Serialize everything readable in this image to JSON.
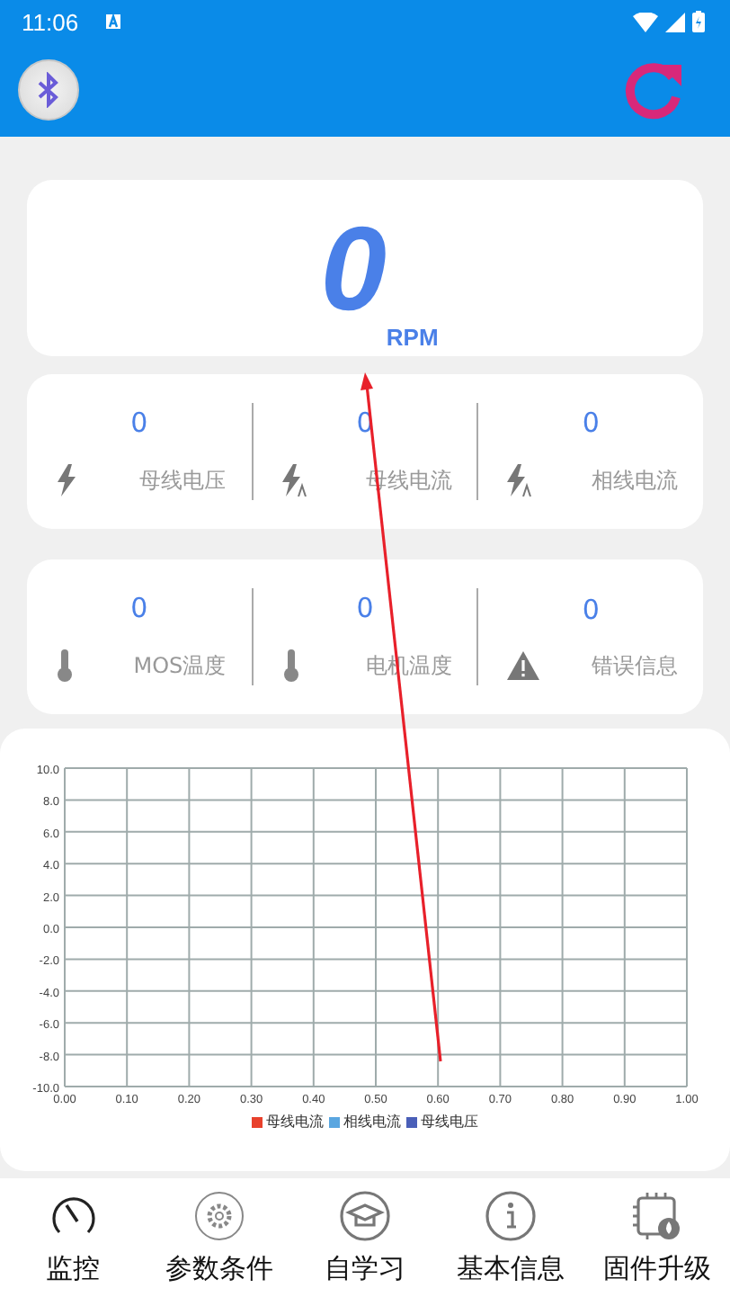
{
  "status_bar": {
    "time": "11:06"
  },
  "speed": {
    "value": "0",
    "unit": "RPM"
  },
  "electrical": [
    {
      "kind": "bolt",
      "value": "0",
      "label": "母线电压"
    },
    {
      "kind": "bolt_a",
      "value": "0",
      "label": "母线电流"
    },
    {
      "kind": "bolt_a",
      "value": "0",
      "label": "相线电流"
    }
  ],
  "thermal": [
    {
      "kind": "thermometer",
      "value": "0",
      "label": "MOS温度"
    },
    {
      "kind": "thermometer",
      "value": "0",
      "label": "电机温度"
    },
    {
      "kind": "warning",
      "value": "0",
      "label": "错误信息"
    }
  ],
  "chart": {
    "chart_data": {
      "type": "line",
      "grid": true,
      "ylim": [
        -10,
        10
      ],
      "categories": [
        "0.00",
        "0.10",
        "0.20",
        "0.30",
        "0.40",
        "0.50",
        "0.60",
        "0.70",
        "0.80",
        "0.90",
        "1.00"
      ],
      "yticks": [
        {
          "value": 10,
          "label": "10.0"
        },
        {
          "value": 8,
          "label": "8.0"
        },
        {
          "value": 6,
          "label": "6.0"
        },
        {
          "value": 4,
          "label": "4.0"
        },
        {
          "value": 2,
          "label": "2.0"
        },
        {
          "value": 0,
          "label": "0.0"
        },
        {
          "value": -2,
          "label": "-2.0"
        },
        {
          "value": -4,
          "label": "-4.0"
        },
        {
          "value": -6,
          "label": "-6.0"
        },
        {
          "value": -8,
          "label": "-8.0"
        },
        {
          "value": -10,
          "label": "-10.0"
        }
      ],
      "series": [
        {
          "name": "母线电流",
          "color": "#e8412c",
          "values": [
            null,
            null,
            null,
            null,
            null,
            null,
            null,
            null,
            null,
            null,
            null
          ]
        },
        {
          "name": "相线电流",
          "color": "#5aa6e0",
          "values": [
            null,
            null,
            null,
            null,
            null,
            null,
            null,
            null,
            null,
            null,
            null
          ]
        },
        {
          "name": "母线电压",
          "color": "#4a5fb8",
          "values": [
            null,
            null,
            null,
            null,
            null,
            null,
            null,
            null,
            null,
            null,
            null
          ]
        }
      ]
    }
  },
  "nav": [
    {
      "kind": "gauge",
      "label": "监控"
    },
    {
      "kind": "gear",
      "label": "参数条件"
    },
    {
      "kind": "cap",
      "label": "自学习"
    },
    {
      "kind": "info",
      "label": "基本信息"
    },
    {
      "kind": "chip",
      "label": "固件升级"
    }
  ]
}
